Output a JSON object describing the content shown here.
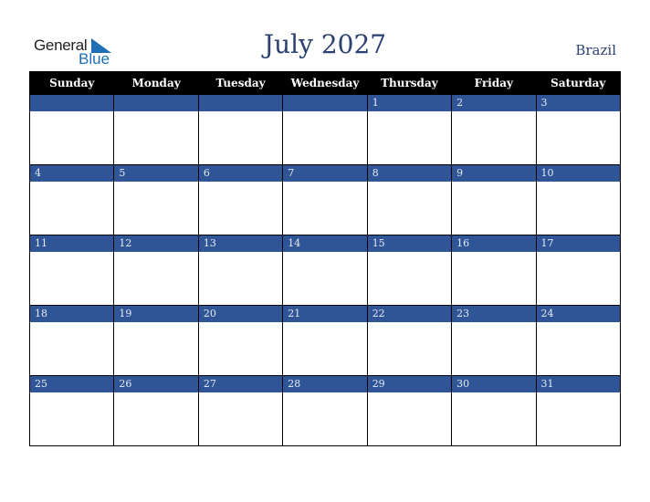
{
  "logo": {
    "line1": "General",
    "line2": "Blue",
    "accent_color": "#1f6fb5"
  },
  "title": "July 2027",
  "country": "Brazil",
  "colors": {
    "header_bg": "#000000",
    "date_band": "#2f5597",
    "title_text": "#2b4170"
  },
  "weekdays": [
    "Sunday",
    "Monday",
    "Tuesday",
    "Wednesday",
    "Thursday",
    "Friday",
    "Saturday"
  ],
  "weeks": [
    [
      "",
      "",
      "",
      "",
      "1",
      "2",
      "3"
    ],
    [
      "4",
      "5",
      "6",
      "7",
      "8",
      "9",
      "10"
    ],
    [
      "11",
      "12",
      "13",
      "14",
      "15",
      "16",
      "17"
    ],
    [
      "18",
      "19",
      "20",
      "21",
      "22",
      "23",
      "24"
    ],
    [
      "25",
      "26",
      "27",
      "28",
      "29",
      "30",
      "31"
    ]
  ]
}
